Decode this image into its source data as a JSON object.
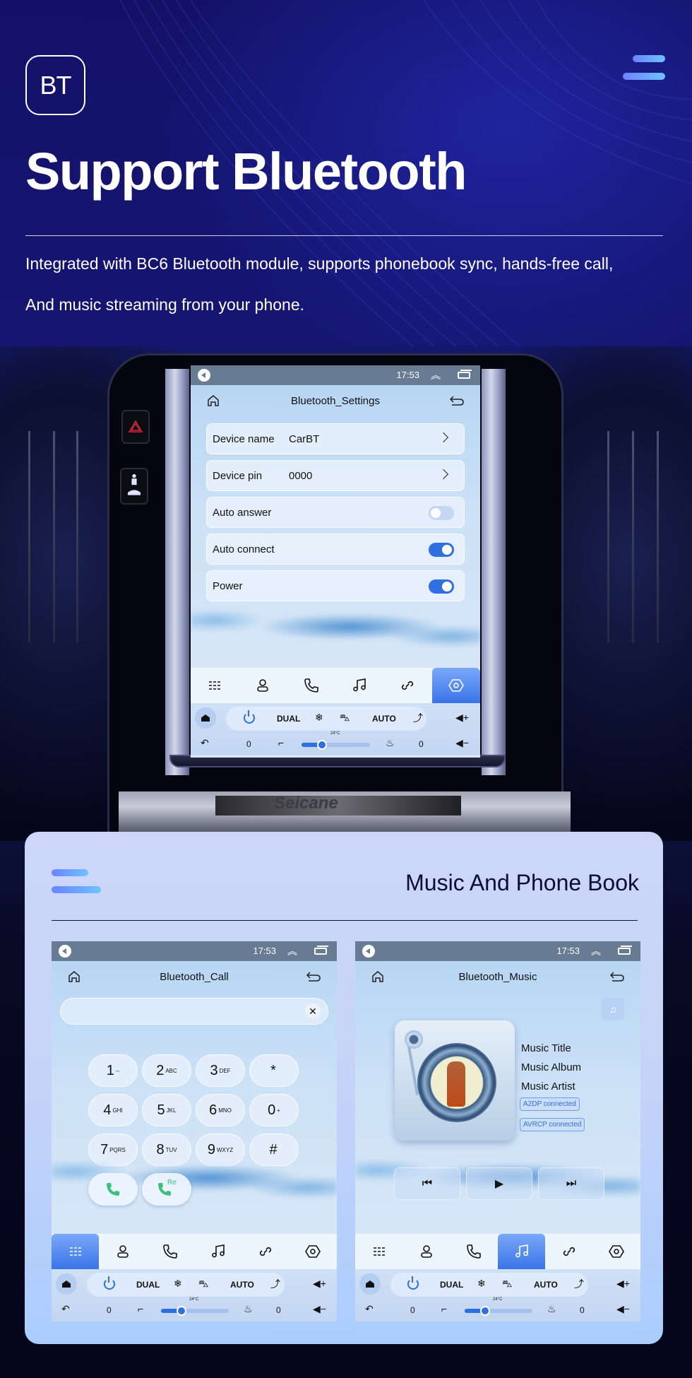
{
  "header": {
    "badge": "BT",
    "title": "Support Bluetooth",
    "description_lines": [
      "Integrated with BC6 Bluetooth module, supports phonebook sync, hands-free call,",
      "And music streaming from your phone."
    ],
    "brand": "Seicane",
    "accent_gradient": [
      "#6c82ff",
      "#6ec3ff"
    ]
  },
  "status_bar": {
    "time": "17:53"
  },
  "settings_screen": {
    "title": "Bluetooth_Settings",
    "rows": [
      {
        "label": "Device name",
        "value": "CarBT",
        "type": "link"
      },
      {
        "label": "Device pin",
        "value": "0000",
        "type": "link"
      },
      {
        "label": "Auto answer",
        "type": "toggle",
        "on": false
      },
      {
        "label": "Auto connect",
        "type": "toggle",
        "on": true
      },
      {
        "label": "Power",
        "type": "toggle",
        "on": true
      }
    ],
    "active_tab": "settings"
  },
  "nav_tabs": [
    "dialpad",
    "contacts",
    "call-log",
    "music",
    "link",
    "settings"
  ],
  "climate": {
    "dual": "DUAL",
    "auto": "AUTO",
    "temp": "24°C",
    "left_seat": "0",
    "right_seat": "0",
    "fan_level": 0.3
  },
  "card": {
    "title": "Music And Phone Book"
  },
  "call_screen": {
    "title": "Bluetooth_Call",
    "field_value": "",
    "keys": [
      {
        "d": "1",
        "s": "--"
      },
      {
        "d": "2",
        "s": "ABC"
      },
      {
        "d": "3",
        "s": "DEF"
      },
      {
        "d": "*",
        "s": ""
      },
      {
        "d": "4",
        "s": "GHI"
      },
      {
        "d": "5",
        "s": "JKL"
      },
      {
        "d": "6",
        "s": "MNO"
      },
      {
        "d": "0",
        "s": "+"
      },
      {
        "d": "7",
        "s": "PQRS"
      },
      {
        "d": "8",
        "s": "TUV"
      },
      {
        "d": "9",
        "s": "WXYZ"
      },
      {
        "d": "#",
        "s": ""
      }
    ],
    "redial_label": "Re",
    "active_tab": "dialpad"
  },
  "music_screen": {
    "title": "Bluetooth_Music",
    "track_title": "Music Title",
    "album": "Music Album",
    "artist": "Music Artist",
    "tags": [
      "A2DP  connected",
      "AVRCP connected"
    ],
    "active_tab": "music"
  }
}
